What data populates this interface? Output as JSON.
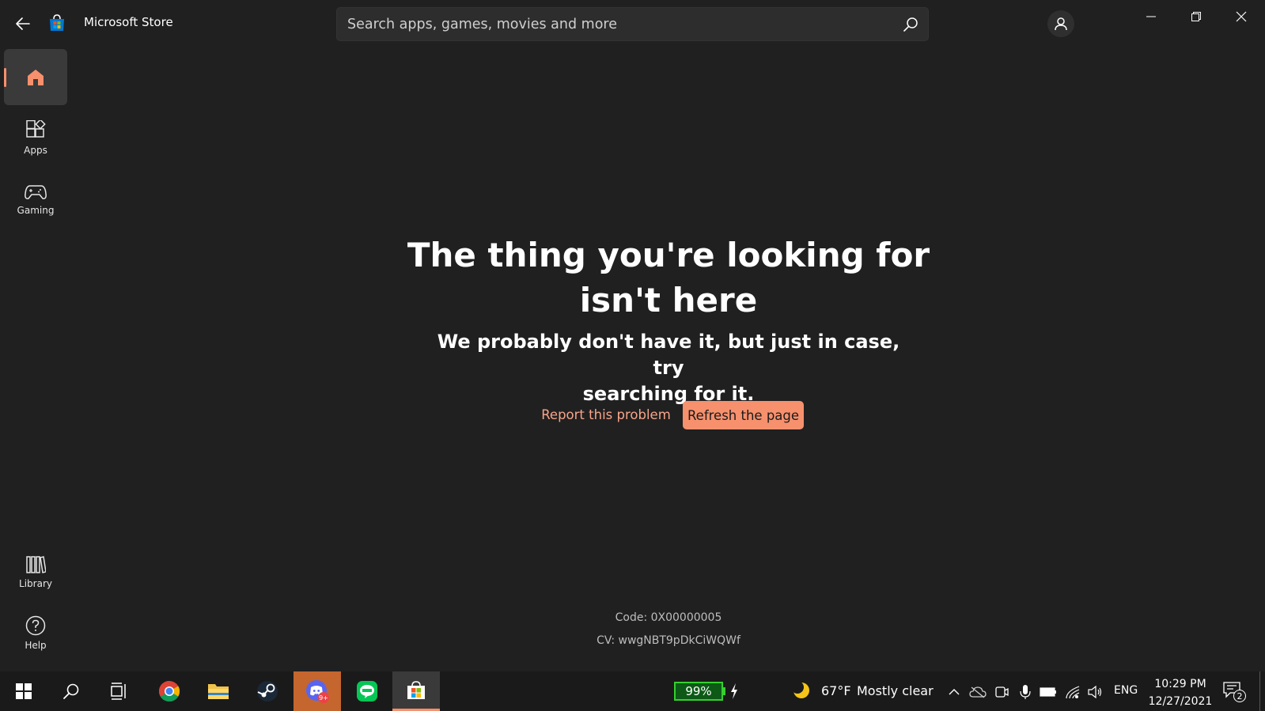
{
  "window": {
    "app_title": "Microsoft Store"
  },
  "search": {
    "placeholder": "Search apps, games, movies and more",
    "value": ""
  },
  "sidebar": {
    "items": [
      {
        "label": "",
        "icon": "home-icon",
        "selected": true
      },
      {
        "label": "Apps",
        "icon": "apps-icon"
      },
      {
        "label": "Gaming",
        "icon": "gamepad-icon"
      },
      {
        "label": "Library",
        "icon": "library-icon"
      },
      {
        "label": "Help",
        "icon": "help-icon"
      }
    ]
  },
  "error": {
    "headline_line1": "The thing you're looking for",
    "headline_line2": "isn't here",
    "subhead_line1": "We probably don't have it, but just in case, try",
    "subhead_line2": "searching for it.",
    "report_link": "Report this problem",
    "refresh_button": "Refresh the page",
    "code": "Code: 0X00000005",
    "cv": "CV: wwgNBT9pDkCiWQWf"
  },
  "taskbar": {
    "pinned": [
      "windows-start-icon",
      "search-icon",
      "task-view-icon",
      "chrome-icon",
      "file-explorer-icon",
      "steam-icon",
      "discord-icon",
      "line-icon",
      "microsoft-store-icon"
    ],
    "discord_badge": "9+",
    "battery_percent": "99%",
    "weather_temp": "67°F",
    "weather_desc": "Mostly clear",
    "language": "ENG",
    "time": "10:29 PM",
    "date": "12/27/2021",
    "notification_count": "2"
  },
  "colors": {
    "background": "#202020",
    "accent": "#f7906d",
    "link": "#f7a58a",
    "taskbar": "#1a1a1a",
    "battery_green": "#35d02e"
  }
}
